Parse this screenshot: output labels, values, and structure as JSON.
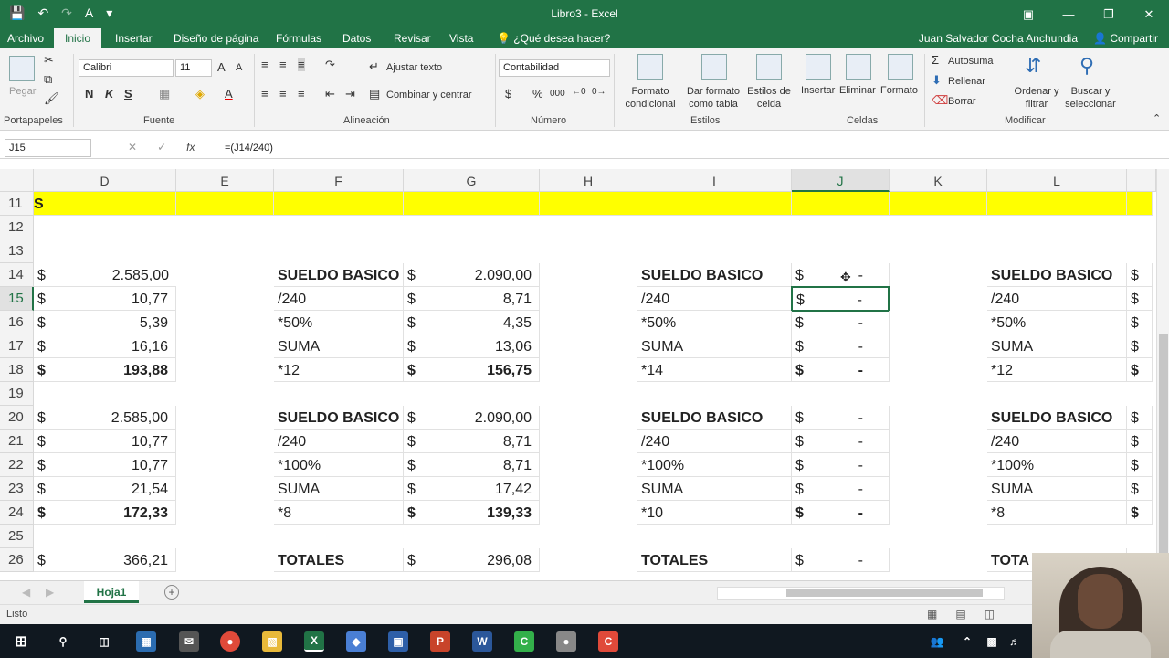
{
  "titlebar": {
    "title": "Libro3 - Excel"
  },
  "menu": {
    "tabs": [
      "Archivo",
      "Inicio",
      "Insertar",
      "Diseño de página",
      "Fórmulas",
      "Datos",
      "Revisar",
      "Vista"
    ],
    "tell_me": "¿Qué desea hacer?",
    "user": "Juan Salvador Cocha Anchundia",
    "share": "Compartir"
  },
  "ribbon": {
    "clipboard": {
      "paste": "Pegar",
      "label": "Portapapeles"
    },
    "font": {
      "name": "Calibri",
      "size": "11",
      "label": "Fuente",
      "bold": "N",
      "italic": "K",
      "underline": "S"
    },
    "alignment": {
      "wrap": "Ajustar texto",
      "merge": "Combinar y centrar",
      "label": "Alineación"
    },
    "number": {
      "format": "Contabilidad",
      "currency": "$",
      "percent": "%",
      "thousands": "000",
      "label": "Número"
    },
    "styles": {
      "conditional": "Formato condicional",
      "table": "Dar formato como tabla",
      "cell_styles": "Estilos de celda",
      "label": "Estilos"
    },
    "cells": {
      "insert": "Insertar",
      "delete": "Eliminar",
      "format": "Formato",
      "label": "Celdas"
    },
    "editing": {
      "autosum": "Autosuma",
      "fill": "Rellenar",
      "clear": "Borrar",
      "sort": "Ordenar y filtrar",
      "find": "Buscar y seleccionar",
      "label": "Modificar"
    }
  },
  "formula_bar": {
    "name_box": "J15",
    "fx": "fx",
    "formula": "=(J14/240)"
  },
  "columns": [
    "D",
    "E",
    "F",
    "G",
    "H",
    "I",
    "J",
    "K",
    "L"
  ],
  "rows": [
    "11",
    "12",
    "13",
    "14",
    "15",
    "16",
    "17",
    "18",
    "19",
    "20",
    "21",
    "22",
    "23",
    "24",
    "25",
    "26"
  ],
  "cells": {
    "r11": {
      "d": "S"
    },
    "r14": {
      "d1": "$",
      "d2": "2.585,00",
      "f": "SUELDO BASICO",
      "g1": "$",
      "g2": "2.090,00",
      "i": "SUELDO BASICO",
      "j1": "$",
      "j2": "-",
      "l": "SUELDO BASICO",
      "l1": "$"
    },
    "r15": {
      "d1": "$",
      "d2": "10,77",
      "f": "/240",
      "g1": "$",
      "g2": "8,71",
      "i": "/240",
      "j1": "$",
      "j2": "-",
      "l": "/240",
      "l1": "$"
    },
    "r16": {
      "d1": "$",
      "d2": "5,39",
      "f": "*50%",
      "g1": "$",
      "g2": "4,35",
      "i": "*50%",
      "j1": "$",
      "j2": "-",
      "l": "*50%",
      "l1": "$"
    },
    "r17": {
      "d1": "$",
      "d2": "16,16",
      "f": "SUMA",
      "g1": "$",
      "g2": "13,06",
      "i": "SUMA",
      "j1": "$",
      "j2": "-",
      "l": "SUMA",
      "l1": "$"
    },
    "r18": {
      "d1": "$",
      "d2": "193,88",
      "f": "*12",
      "g1": "$",
      "g2": "156,75",
      "i": "*14",
      "j1": "$",
      "j2": "-",
      "l": "*12",
      "l1": "$"
    },
    "r20": {
      "d1": "$",
      "d2": "2.585,00",
      "f": "SUELDO BASICO",
      "g1": "$",
      "g2": "2.090,00",
      "i": "SUELDO BASICO",
      "j1": "$",
      "j2": "-",
      "l": "SUELDO BASICO",
      "l1": "$"
    },
    "r21": {
      "d1": "$",
      "d2": "10,77",
      "f": "/240",
      "g1": "$",
      "g2": "8,71",
      "i": "/240",
      "j1": "$",
      "j2": "-",
      "l": "/240",
      "l1": "$"
    },
    "r22": {
      "d1": "$",
      "d2": "10,77",
      "f": "*100%",
      "g1": "$",
      "g2": "8,71",
      "i": "*100%",
      "j1": "$",
      "j2": "-",
      "l": "*100%",
      "l1": "$"
    },
    "r23": {
      "d1": "$",
      "d2": "21,54",
      "f": "SUMA",
      "g1": "$",
      "g2": "17,42",
      "i": "SUMA",
      "j1": "$",
      "j2": "-",
      "l": "SUMA",
      "l1": "$"
    },
    "r24": {
      "d1": "$",
      "d2": "172,33",
      "f": "*8",
      "g1": "$",
      "g2": "139,33",
      "i": "*10",
      "j1": "$",
      "j2": "-",
      "l": "*8",
      "l1": "$"
    },
    "r26": {
      "d1": "$",
      "d2": "366,21",
      "f": "TOTALES",
      "g1": "$",
      "g2": "296,08",
      "i": "TOTALES",
      "j1": "$",
      "j2": "-",
      "l": "TOTA"
    }
  },
  "sheet": {
    "tab": "Hoja1",
    "add": "+"
  },
  "status": {
    "text": "Listo"
  },
  "colors": {
    "excel_green": "#217346",
    "highlight_yellow": "#ffff00"
  }
}
